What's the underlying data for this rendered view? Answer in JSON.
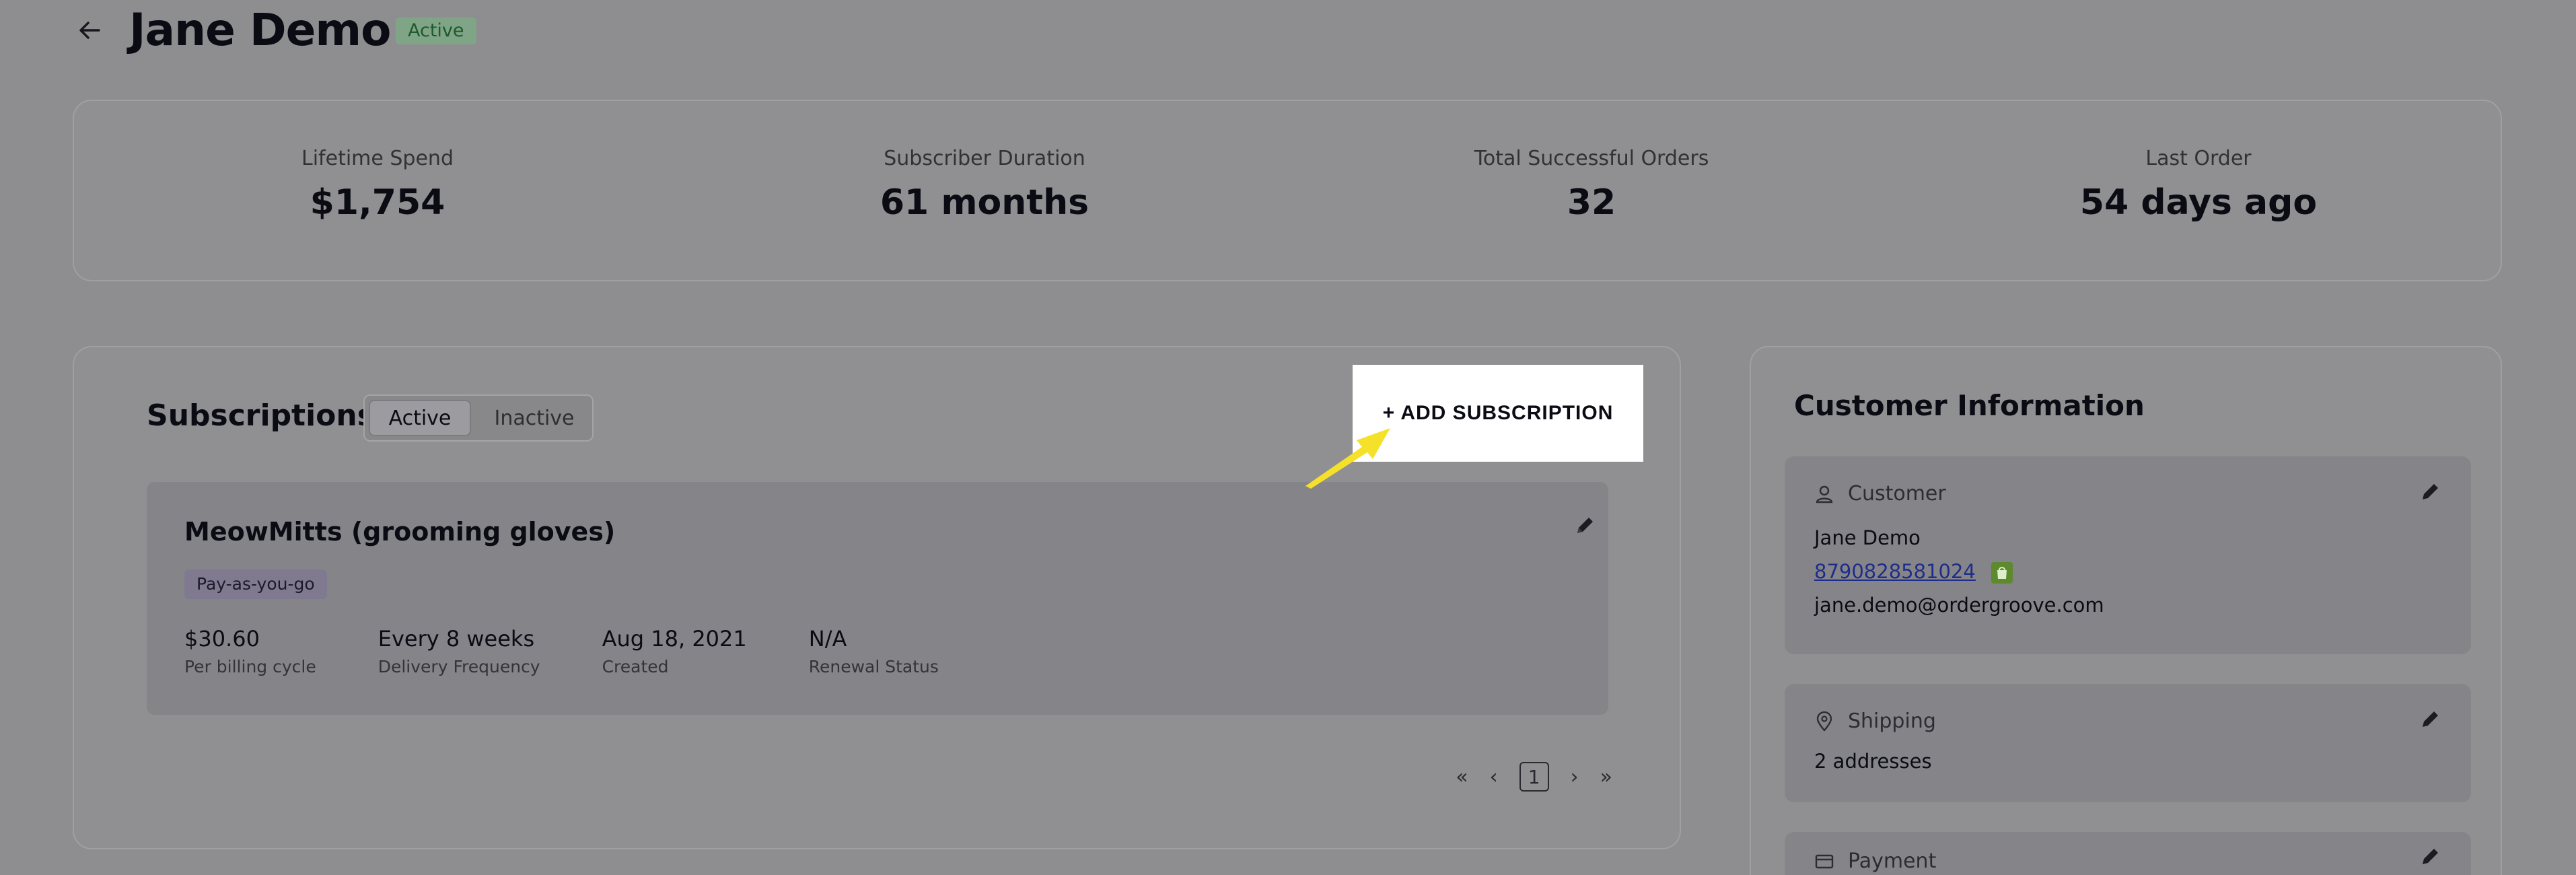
{
  "header": {
    "title": "Jane Demo",
    "status": "Active"
  },
  "stats": [
    {
      "label": "Lifetime Spend",
      "value": "$1,754"
    },
    {
      "label": "Subscriber Duration",
      "value": "61 months"
    },
    {
      "label": "Total Successful Orders",
      "value": "32"
    },
    {
      "label": "Last Order",
      "value": "54 days ago"
    }
  ],
  "subscriptions": {
    "title": "Subscriptions",
    "tabs": [
      {
        "label": "Active"
      },
      {
        "label": "Inactive"
      }
    ],
    "add_button": "+ ADD SUBSCRIPTION",
    "items": [
      {
        "name": "MeowMitts (grooming gloves)",
        "tag": "Pay-as-you-go",
        "fields": [
          {
            "value": "$30.60",
            "label": "Per billing cycle"
          },
          {
            "value": "Every 8 weeks",
            "label": "Delivery Frequency"
          },
          {
            "value": "Aug 18, 2021",
            "label": "Created"
          },
          {
            "value": "N/A",
            "label": "Renewal Status"
          }
        ]
      }
    ],
    "pager": {
      "first": "«",
      "prev": "‹",
      "current": "1",
      "next": "›",
      "last": "»"
    }
  },
  "customer_info": {
    "title": "Customer Information",
    "customer": {
      "heading": "Customer",
      "name": "Jane Demo",
      "phone": "8790828581024",
      "email": "jane.demo@ordergroove.com"
    },
    "shipping": {
      "heading": "Shipping",
      "summary": "2 addresses"
    },
    "payment": {
      "heading": "Payment"
    }
  },
  "colors": {
    "highlight": "#ffffff",
    "annotation_arrow": "#f5e02a",
    "status_badge": "#7fa486",
    "shop_badge": "#5c8a2c"
  }
}
